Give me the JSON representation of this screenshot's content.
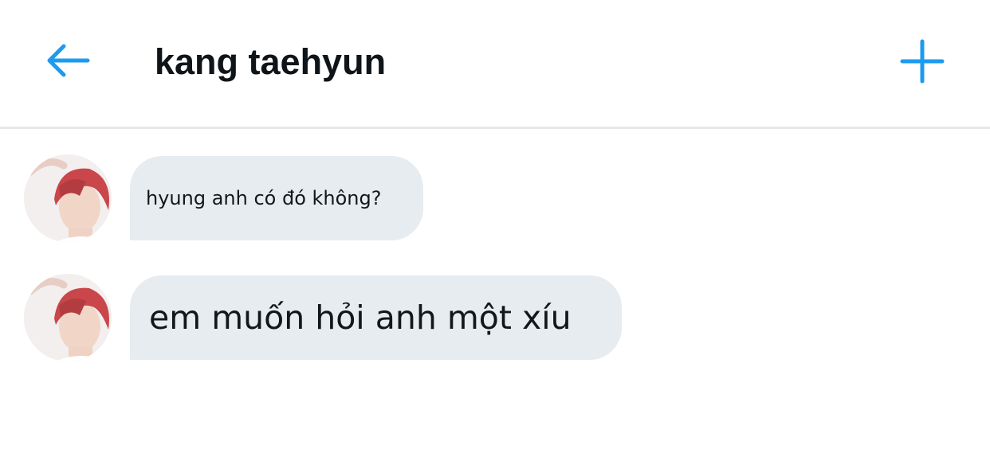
{
  "header": {
    "title": "kang taehyun",
    "back_icon": "arrow-left-icon",
    "add_icon": "plus-icon"
  },
  "messages": [
    {
      "text": "hyung anh có đó không?",
      "avatar_icon": "avatar-photo"
    },
    {
      "text": "em muốn hỏi anh một xíu",
      "avatar_icon": "avatar-photo"
    }
  ],
  "colors": {
    "accent": "#1d9bf0",
    "bubble": "#e6ecf0",
    "divider": "#e6e9ec",
    "text": "#0f1419"
  }
}
